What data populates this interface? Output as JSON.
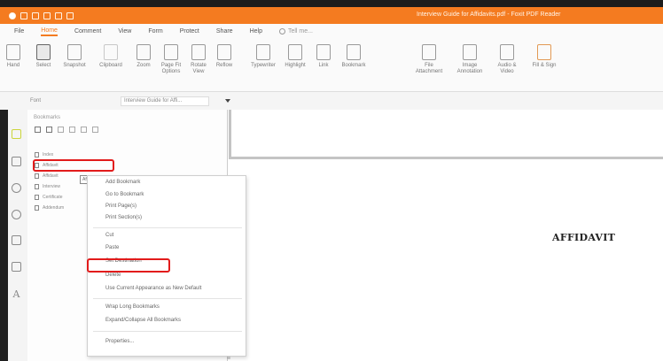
{
  "window": {
    "title": "Interview Guide for Affidavits.pdf - Foxit PDF Reader"
  },
  "menu": [
    "File",
    "Home",
    "Comment",
    "View",
    "Form",
    "Protect",
    "Share",
    "Help"
  ],
  "tell_me": "Tell me...",
  "ribbon": {
    "buttons": [
      "Hand",
      "Select",
      "Snapshot",
      "Clipboard",
      "Zoom",
      "Page Fit Options",
      "Rotate View",
      "Reflow",
      "Typewriter",
      "Highlight",
      "Link",
      "Bookmark",
      "File Attachment",
      "Image Annotation",
      "Audio & Video",
      "Fill & Sign"
    ]
  },
  "font_row": {
    "label": "Font",
    "value": "Interview Guide for Affi..."
  },
  "bookmarks_panel": {
    "title": "Bookmarks",
    "items": [
      "Index",
      "Affidavit",
      "Affidavit",
      "Interview",
      "Certificate",
      "Addendum"
    ],
    "tooltip": "Affidavit"
  },
  "context_menu": {
    "items": [
      "Add Bookmark",
      "Go to Bookmark",
      "Print Page(s)",
      "Print Section(s)",
      "Cut",
      "Paste",
      "Set Destination",
      "Delete",
      "Use Current Appearance as New Default",
      "Wrap Long Bookmarks",
      "Expand/Collapse All Bookmarks",
      "Properties..."
    ]
  },
  "document": {
    "heading": "AFFIDAVIT"
  },
  "colors": {
    "accent": "#f47b20",
    "highlight_box": "#e21b1b"
  }
}
